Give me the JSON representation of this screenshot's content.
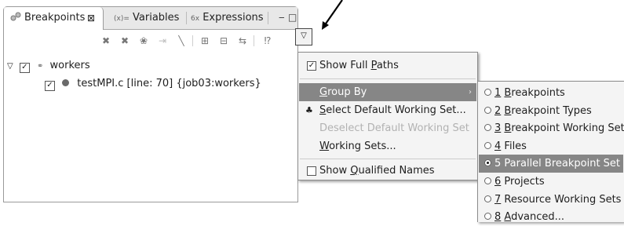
{
  "tabs": {
    "breakpoints": "Breakpoints",
    "breakpoints_close": "⊠",
    "variables_icon": "(x)=",
    "variables": "Variables",
    "expressions_icon": "6x",
    "expressions": "Expressions",
    "minimize": "‒",
    "maximize": "□"
  },
  "tree": {
    "root_label": "workers",
    "child_label": "testMPI.c [line: 70] {job03:workers}"
  },
  "menu": {
    "show_full_paths_pre": "Show Full ",
    "show_full_paths_mn": "P",
    "show_full_paths_post": "aths",
    "group_by_mn": "G",
    "group_by_post": "roup By",
    "select_default_mn": "S",
    "select_default_post": "elect Default Working Set...",
    "deselect_default": "Deselect Default Working Set",
    "working_sets_mn": "W",
    "working_sets_post": "orking Sets...",
    "show_qualified_pre": "Show ",
    "show_qualified_mn": "Q",
    "show_qualified_post": "ualified Names"
  },
  "submenu": {
    "items": [
      {
        "num": "1",
        "text": " Breakpoints",
        "mn": "B",
        "rest": "reakpoints",
        "selected": false
      },
      {
        "num": "2",
        "text": " Breakpoint Types",
        "mn": "B",
        "rest": "reakpoint Types",
        "selected": false
      },
      {
        "num": "3",
        "text": " Breakpoint Working Set",
        "mn": "B",
        "rest": "reakpoint Working Set",
        "selected": false
      },
      {
        "num": "4",
        "text": " Files",
        "mn": "",
        "rest": "Files",
        "selected": false
      },
      {
        "num": "5",
        "text": " Parallel Breakpoint Set",
        "mn": "",
        "rest": "Parallel Breakpoint Set",
        "selected": true
      },
      {
        "num": "6",
        "text": " Projects",
        "mn": "",
        "rest": "Projects",
        "selected": false
      },
      {
        "num": "7",
        "text": " Resource Working Sets",
        "mn": "",
        "rest": "Resource Working Sets",
        "selected": false
      },
      {
        "num": "8",
        "text": " Advanced...",
        "mn": "A",
        "rest": "dvanced...",
        "selected": false
      }
    ]
  },
  "colors": {
    "selection": "#868686",
    "menu_bg": "#f4f4f4"
  }
}
